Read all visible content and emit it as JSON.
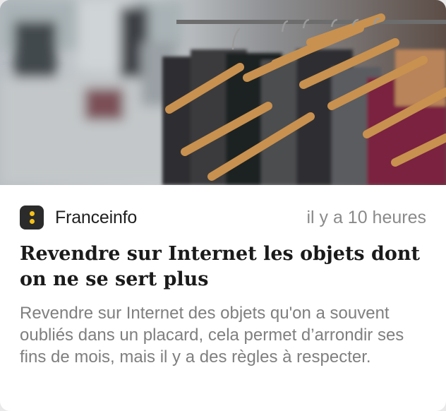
{
  "article": {
    "image_icon": "clothing-rack-photo",
    "source": {
      "name": "Franceinfo",
      "logo_icon": "franceinfo-logo-icon",
      "logo_bg_color": "#2b2b2b",
      "logo_dot_color": "#f6c21a"
    },
    "timestamp": "il y a 10 heures",
    "headline": "Revendre sur Internet les objets dont on ne se sert plus",
    "excerpt": "Revendre sur Internet des objets qu'on a souvent oubliés dans un placard, cela permet d’arrondir ses fins de mois, mais il y a des règles à respecter."
  }
}
